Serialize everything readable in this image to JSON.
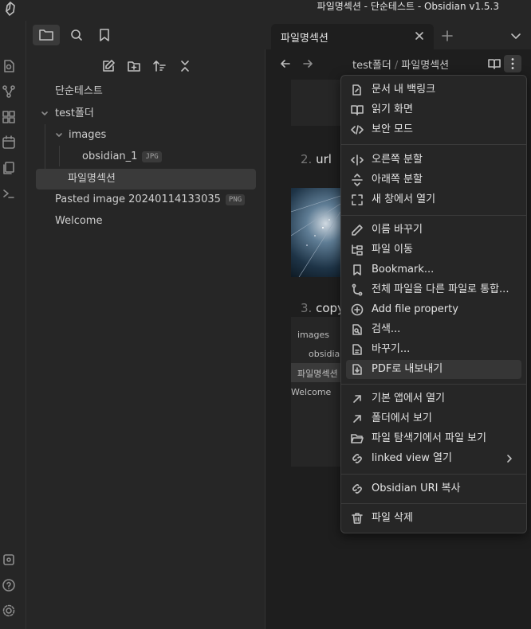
{
  "window": {
    "title": "파일명섹션 - 단순테스트 - Obsidian v1.5.3"
  },
  "tabs": [
    {
      "label": "파일명섹션"
    }
  ],
  "ribbon": {
    "icons": [
      "switcher-icon",
      "graph-icon",
      "canvas-icon",
      "daily-note-icon",
      "templates-icon",
      "terminal-icon",
      "vault-icon",
      "help-icon",
      "settings-icon"
    ]
  },
  "sidebar": {
    "vault_name": "단순테스트",
    "tree": [
      {
        "label": "test폴더",
        "type": "folder"
      },
      {
        "label": "images",
        "type": "folder"
      },
      {
        "label": "obsidian_1",
        "type": "file",
        "badge": "JPG"
      },
      {
        "label": "파일명섹션",
        "type": "file"
      },
      {
        "label": "Pasted image 20240114133035",
        "type": "file",
        "badge": "PNG"
      },
      {
        "label": "Welcome",
        "type": "file"
      }
    ]
  },
  "editor": {
    "breadcrumb": {
      "folder": "test폴더",
      "sep": "/",
      "file": "파일명섹션"
    },
    "headings": [
      {
        "num": "2.",
        "text": "url"
      },
      {
        "num": "3.",
        "text": "copy"
      }
    ],
    "embedded_tree": [
      "images",
      "obsidian",
      "파일명섹션",
      "Welcome"
    ]
  },
  "menu": {
    "groups": [
      [
        {
          "icon": "link-icon",
          "label": "문서 내 백링크"
        },
        {
          "icon": "book-open-icon",
          "label": "읽기 화면"
        },
        {
          "icon": "code-icon",
          "label": "보안 모드"
        }
      ],
      [
        {
          "icon": "split-vertical-icon",
          "label": "오른쪽 분할"
        },
        {
          "icon": "split-horizontal-icon",
          "label": "아래쪽 분할"
        },
        {
          "icon": "maximize-icon",
          "label": "새 창에서 열기"
        }
      ],
      [
        {
          "icon": "pencil-icon",
          "label": "이름 바꾸기"
        },
        {
          "icon": "folder-tree-icon",
          "label": "파일 이동"
        },
        {
          "icon": "bookmark-icon",
          "label": "Bookmark..."
        },
        {
          "icon": "merge-icon",
          "label": "전체 파일을 다른 파일로 통합..."
        },
        {
          "icon": "plus-circle-icon",
          "label": "Add file property"
        },
        {
          "icon": "file-search-icon",
          "label": "검색..."
        },
        {
          "icon": "file-replace-icon",
          "label": "바꾸기..."
        },
        {
          "icon": "file-download-icon",
          "label": "PDF로 내보내기",
          "highlight": true
        }
      ],
      [
        {
          "icon": "arrow-up-right-icon",
          "label": "기본 앱에서 열기"
        },
        {
          "icon": "arrow-up-right-icon",
          "label": "폴더에서 보기"
        },
        {
          "icon": "folder-open-icon",
          "label": "파일 탐색기에서 파일 보기"
        },
        {
          "icon": "link-2-icon",
          "label": "linked view 열기",
          "submenu": true
        }
      ],
      [
        {
          "icon": "link-icon",
          "label": "Obsidian URI 복사"
        }
      ],
      [
        {
          "icon": "trash-icon",
          "label": "파일 삭제"
        }
      ]
    ]
  },
  "colors": {
    "bg": "#1e1e1e",
    "panel": "#262626",
    "accent_selected": "#3a3a3a"
  }
}
